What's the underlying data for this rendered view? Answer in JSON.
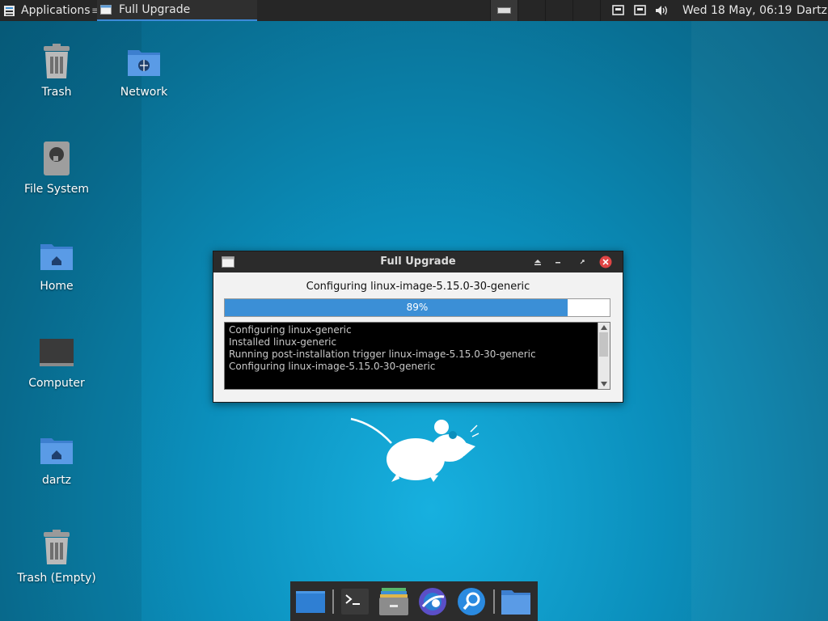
{
  "panel": {
    "menu_label": "Applications",
    "task_title": "Full Upgrade",
    "clock": "Wed 18 May, 06:19",
    "user": "Dartz"
  },
  "desktop": {
    "icons": [
      {
        "label": "Trash",
        "icon": "trash-icon"
      },
      {
        "label": "Network",
        "icon": "network-folder-icon"
      },
      {
        "label": "File System",
        "icon": "drive-icon"
      },
      {
        "label": "Home",
        "icon": "home-folder-icon"
      },
      {
        "label": "Computer",
        "icon": "monitor-icon"
      },
      {
        "label": "dartz",
        "icon": "home-folder-icon"
      },
      {
        "label": "Trash (Empty)",
        "icon": "trash-icon"
      }
    ]
  },
  "dialog": {
    "title": "Full Upgrade",
    "status": "Configuring linux-image-5.15.0-30-generic",
    "progress": 0.89,
    "progress_label": "89%",
    "log_lines": [
      "Configuring linux-generic",
      "Installed linux-generic",
      "Running post-installation trigger linux-image-5.15.0-30-generic",
      "Configuring linux-image-5.15.0-30-generic"
    ]
  },
  "dock": {
    "items": [
      "show-desktop-icon",
      "terminal-icon",
      "file-manager-icon",
      "web-browser-icon",
      "search-icon",
      "folder-icon"
    ]
  },
  "colors": {
    "accent": "#3b8fd6",
    "panel": "#262626",
    "desktop": "#0b8fbc"
  }
}
